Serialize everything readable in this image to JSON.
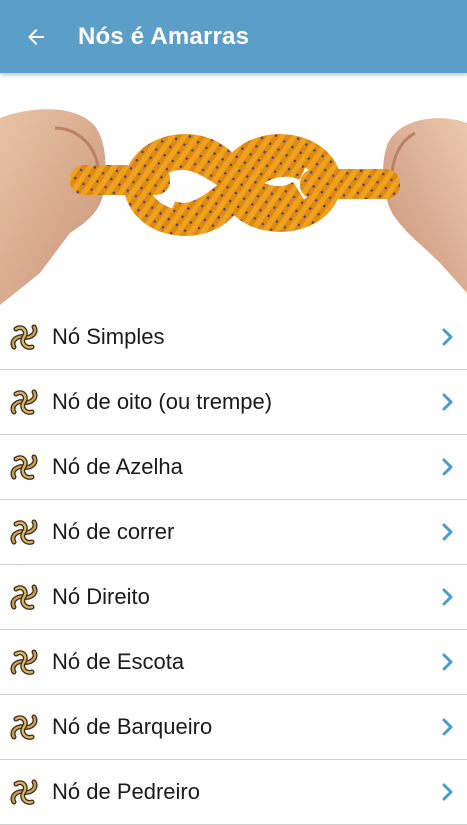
{
  "header": {
    "title": "Nós é Amarras",
    "back_icon": "arrow-left-icon",
    "background": "#5b9ec8"
  },
  "hero": {
    "image": "hands-holding-figure-eight-knot-rope"
  },
  "list": {
    "item_icon": "knot-icon",
    "trailing_icon": "chevron-right-icon",
    "chevron_color": "#4a9cc9",
    "items": [
      {
        "label": "Nó Simples"
      },
      {
        "label": "Nó de oito (ou trempe)"
      },
      {
        "label": "Nó de Azelha"
      },
      {
        "label": "Nó de correr"
      },
      {
        "label": "Nó Direito"
      },
      {
        "label": "Nó de Escota"
      },
      {
        "label": "Nó de Barqueiro"
      },
      {
        "label": "Nó de Pedreiro"
      }
    ]
  }
}
